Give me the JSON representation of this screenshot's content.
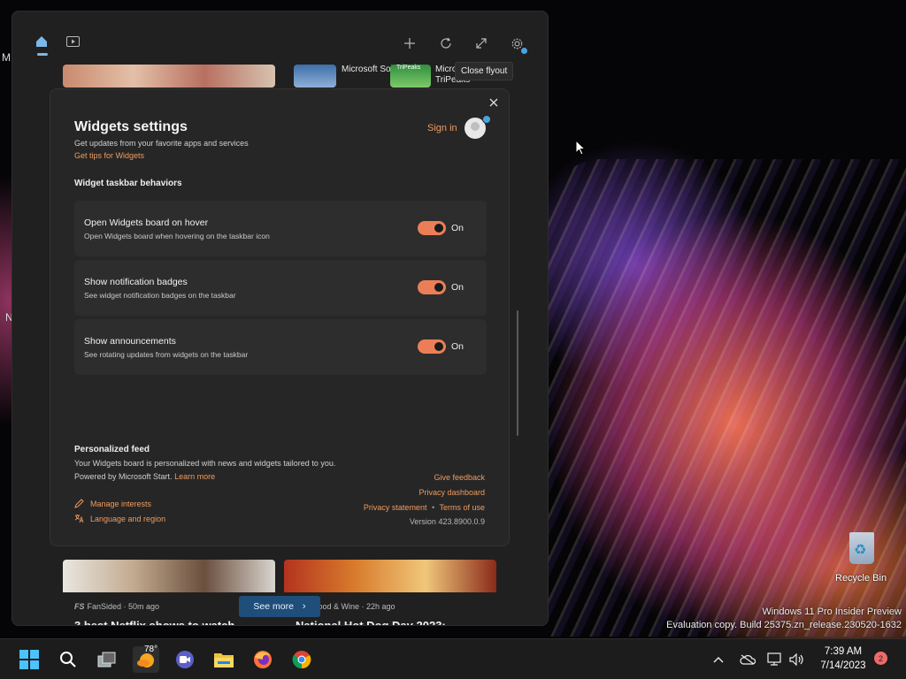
{
  "desktop": {
    "side_letters": [
      "M",
      "N"
    ],
    "recycle_bin": {
      "label": "Recycle Bin",
      "icon": "recycle-bin-icon"
    },
    "watermark": {
      "line1": "Windows 11 Pro Insider Preview",
      "line2": "Evaluation copy. Build 25375.zn_release.230520-1632"
    }
  },
  "board": {
    "top_icons": [
      "home-icon",
      "video-icon",
      "add-icon",
      "refresh-icon",
      "expand-icon",
      "gear-icon"
    ],
    "peek": {
      "item1": "Microsoft Solitaire",
      "item2_line1": "Micro",
      "item2_line2": "TriPeaks",
      "thumb_label": "TriPeaks"
    },
    "tooltip": "Close flyout",
    "feed": {
      "card1": {
        "source": "FanSided · 50m ago",
        "headline": "3 best Netflix shows to watch",
        "source_icon": "FS"
      },
      "card2": {
        "source": "Food & Wine · 22h ago",
        "headline": "National Hot Dog Day 2023:"
      },
      "see_more": "See more"
    }
  },
  "settings": {
    "close_icon": "close-icon",
    "title": "Widgets settings",
    "subtitle": "Get updates from your favorite apps and services",
    "tips_link": "Get tips for Widgets",
    "sign_in": "Sign in",
    "section": "Widget taskbar behaviors",
    "options": [
      {
        "title": "Open Widgets board on hover",
        "desc": "Open Widgets board when hovering on the taskbar icon",
        "state": "On"
      },
      {
        "title": "Show notification badges",
        "desc": "See widget notification badges on the taskbar",
        "state": "On"
      },
      {
        "title": "Show announcements",
        "desc": "See rotating updates from widgets on the taskbar",
        "state": "On"
      }
    ],
    "personalized": {
      "title": "Personalized feed",
      "text": "Your Widgets board is personalized with news and widgets tailored to you. Powered by Microsoft Start.",
      "learn_more": "Learn more",
      "manage_interests": "Manage interests",
      "language_region": "Language and region",
      "give_feedback": "Give feedback",
      "privacy_dashboard": "Privacy dashboard",
      "privacy_statement": "Privacy statement",
      "separator": "•",
      "terms": "Terms of use",
      "version": "Version 423.8900.0.9"
    }
  },
  "taskbar": {
    "weather_temp": "78°",
    "apps": [
      "start-icon",
      "search-icon",
      "task-view-icon",
      "widgets-weather-icon",
      "teams-icon",
      "file-explorer-icon",
      "firefox-icon",
      "chrome-icon"
    ],
    "time": "7:39 AM",
    "date": "7/14/2023",
    "notification_count": "2"
  },
  "colors": {
    "accent": "#ec7e57",
    "link": "#ef9b60",
    "see_more_bg": "#1f4e7a",
    "start_blue": "#4cc2ff"
  }
}
